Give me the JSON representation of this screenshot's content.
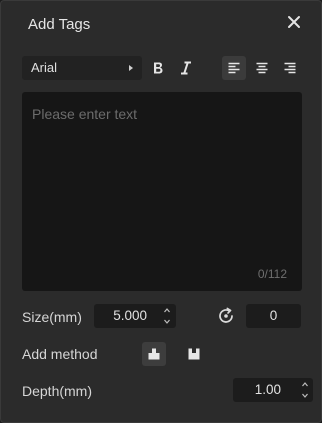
{
  "dialog": {
    "title": "Add Tags"
  },
  "toolbar": {
    "font": "Arial",
    "bold_icon": "bold-icon",
    "italic_icon": "italic-icon",
    "align_left_icon": "align-left-icon",
    "align_center_icon": "align-center-icon",
    "align_right_icon": "align-right-icon",
    "active_alignment": "left"
  },
  "text": {
    "value": "",
    "placeholder": "Please enter text",
    "char_count": "0/112"
  },
  "size": {
    "label": "Size(mm)",
    "value": "5.000"
  },
  "rotation": {
    "icon": "rotate-icon",
    "value": "0"
  },
  "add_method": {
    "label": "Add method",
    "options": [
      "emboss-icon",
      "engrave-icon"
    ],
    "selected": "emboss"
  },
  "depth": {
    "label": "Depth(mm)",
    "value": "1.00"
  },
  "colors": {
    "panel": "#2b2b2b",
    "input": "#1c1c1c",
    "text_area": "#161616",
    "text": "#d8d8d8"
  }
}
